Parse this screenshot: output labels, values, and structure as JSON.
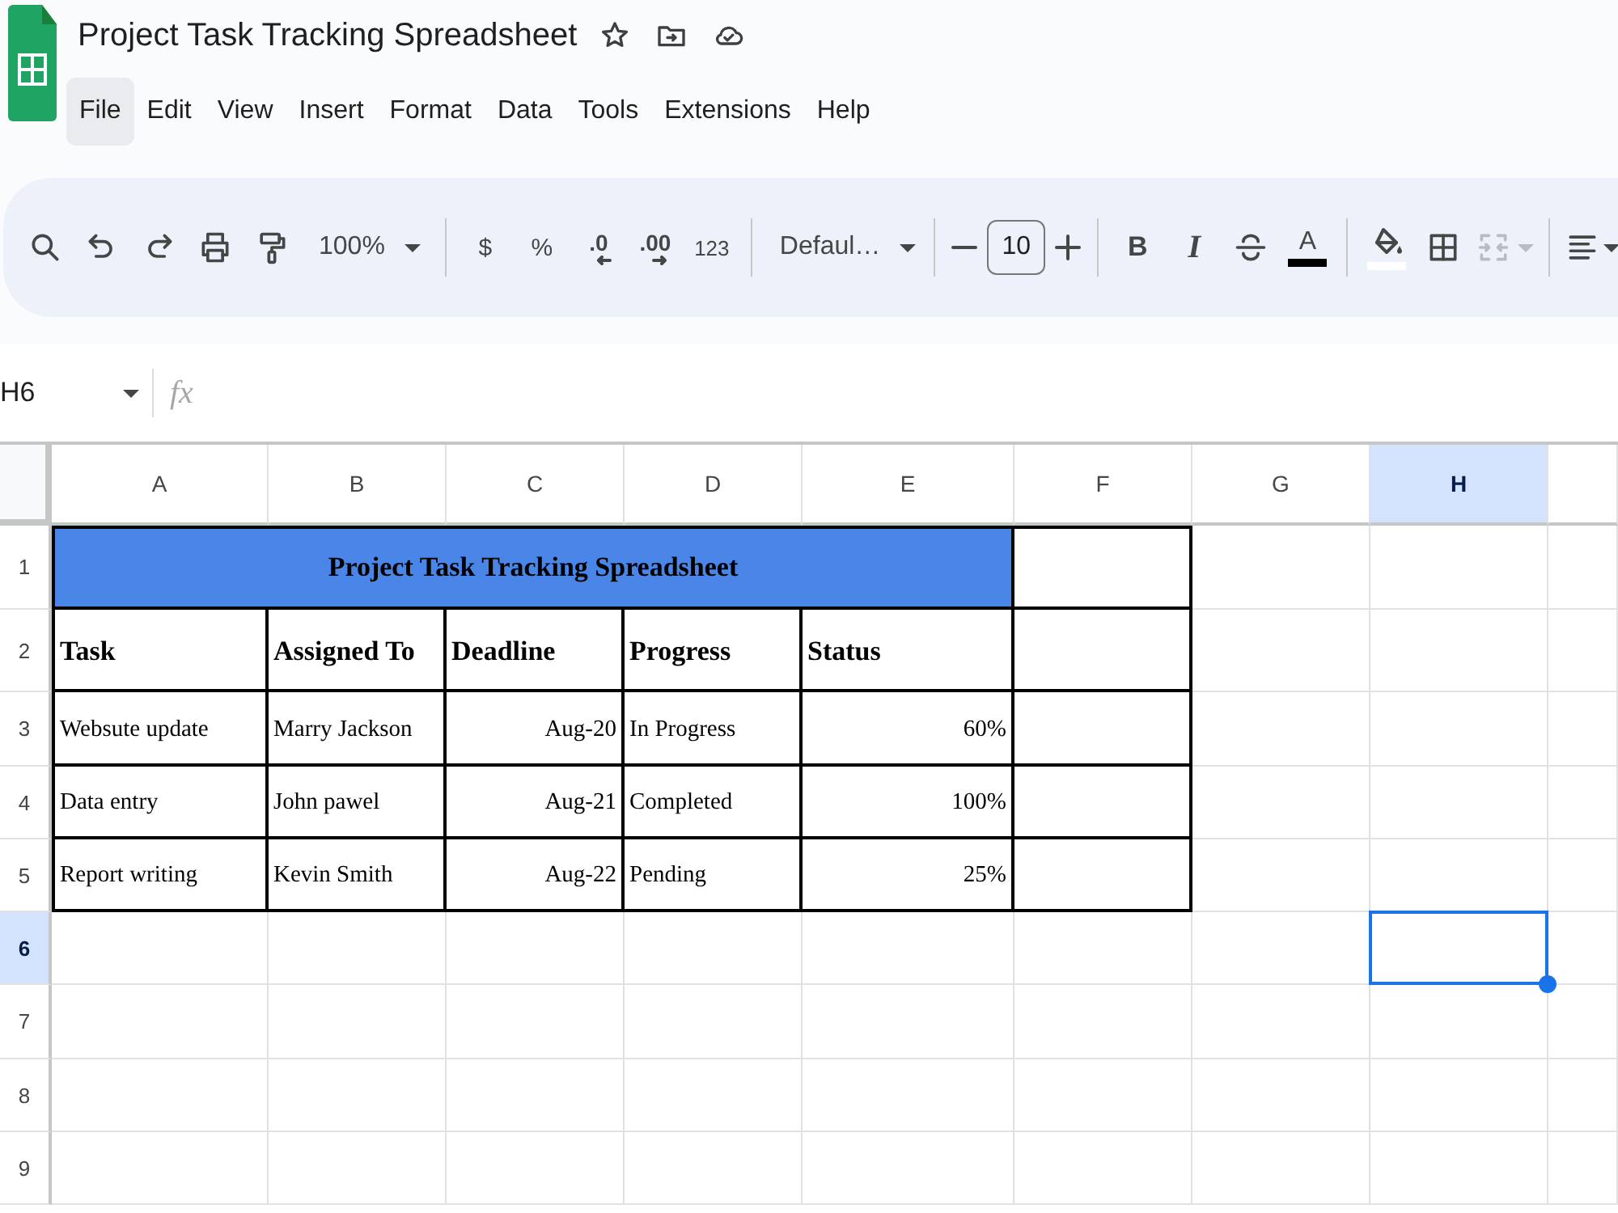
{
  "app": {
    "title": "Project Task Tracking Spreadsheet"
  },
  "menu": [
    {
      "label": "File",
      "selected": true
    },
    {
      "label": "Edit",
      "selected": false
    },
    {
      "label": "View",
      "selected": false
    },
    {
      "label": "Insert",
      "selected": false
    },
    {
      "label": "Format",
      "selected": false
    },
    {
      "label": "Data",
      "selected": false
    },
    {
      "label": "Tools",
      "selected": false
    },
    {
      "label": "Extensions",
      "selected": false
    },
    {
      "label": "Help",
      "selected": false
    }
  ],
  "toolbar": {
    "zoom": "100%",
    "currency": "$",
    "percent": "%",
    "decrease_decimals": ".0",
    "increase_decimals": ".00",
    "number_format": "123",
    "font": "Defaul…",
    "font_size": "10",
    "bold": "B",
    "italic": "I",
    "text_color": "A",
    "merge": {
      "disabled": true
    }
  },
  "formula_bar": {
    "cell_reference": "H6",
    "function_label": "fx"
  },
  "sheet": {
    "columns": [
      {
        "label": "A",
        "selected": false
      },
      {
        "label": "B",
        "selected": false
      },
      {
        "label": "C",
        "selected": false
      },
      {
        "label": "D",
        "selected": false
      },
      {
        "label": "E",
        "selected": false
      },
      {
        "label": "F",
        "selected": false
      },
      {
        "label": "G",
        "selected": false
      },
      {
        "label": "H",
        "selected": true
      }
    ],
    "rows": [
      {
        "label": "1",
        "selected": false
      },
      {
        "label": "2",
        "selected": false
      },
      {
        "label": "3",
        "selected": false
      },
      {
        "label": "4",
        "selected": false
      },
      {
        "label": "5",
        "selected": false
      },
      {
        "label": "6",
        "selected": true
      },
      {
        "label": "7",
        "selected": false
      },
      {
        "label": "8",
        "selected": false
      },
      {
        "label": "9",
        "selected": false
      }
    ],
    "banner": "Project Task Tracking Spreadsheet",
    "headers": [
      "Task",
      "Assigned To",
      "Deadline",
      "Progress",
      "Status"
    ],
    "records": [
      [
        {
          "text": "Websute update",
          "kind": "text"
        },
        {
          "text": "Marry Jackson",
          "kind": "text"
        },
        {
          "text": "Aug-20",
          "kind": "date"
        },
        {
          "text": "In Progress",
          "kind": "text"
        },
        {
          "text": "60%",
          "kind": "number"
        }
      ],
      [
        {
          "text": "Data entry",
          "kind": "text"
        },
        {
          "text": "John pawel",
          "kind": "text"
        },
        {
          "text": "Aug-21",
          "kind": "date"
        },
        {
          "text": "Completed",
          "kind": "text"
        },
        {
          "text": "100%",
          "kind": "number"
        }
      ],
      [
        {
          "text": "Report writing",
          "kind": "text"
        },
        {
          "text": "Kevin Smith",
          "kind": "text"
        },
        {
          "text": "Aug-22",
          "kind": "date"
        },
        {
          "text": "Pending",
          "kind": "text"
        },
        {
          "text": "25%",
          "kind": "number"
        }
      ]
    ]
  }
}
